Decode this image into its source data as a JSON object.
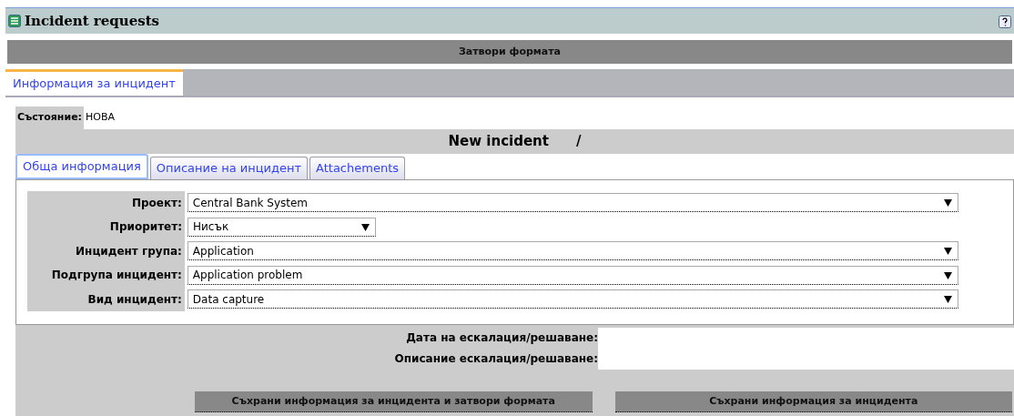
{
  "window": {
    "title": "Incident requests"
  },
  "close_form_button": "Затвори формата",
  "main_tabs": [
    {
      "label": "Информация за инцидент",
      "selected": true
    }
  ],
  "status": {
    "label": "Състояние:",
    "value": "НОВА"
  },
  "heading": {
    "title": "New incident",
    "separator": "/"
  },
  "sub_tabs": [
    {
      "label": "Обща информация",
      "selected": true
    },
    {
      "label": "Описание на инцидент",
      "selected": false
    },
    {
      "label": "Attachements",
      "selected": false
    }
  ],
  "fields": [
    {
      "label": "Проект:",
      "value": "Central Bank System",
      "wide": true
    },
    {
      "label": "Приоритет:",
      "value": "Нисък",
      "wide": false
    },
    {
      "label": "Инцидент група:",
      "value": "Application",
      "wide": true
    },
    {
      "label": "Подгрупа инцидент:",
      "value": "Application problem",
      "wide": true
    },
    {
      "label": "Вид инцидент:",
      "value": "Data capture",
      "wide": true
    }
  ],
  "escalation": [
    {
      "label": "Дата на ескалация/решаване:"
    },
    {
      "label": "Описание ескалация/решаване:"
    }
  ],
  "buttons": [
    "Съхрани информация за инцидента и затвори формата",
    "Съхрани информация за инцидента"
  ]
}
